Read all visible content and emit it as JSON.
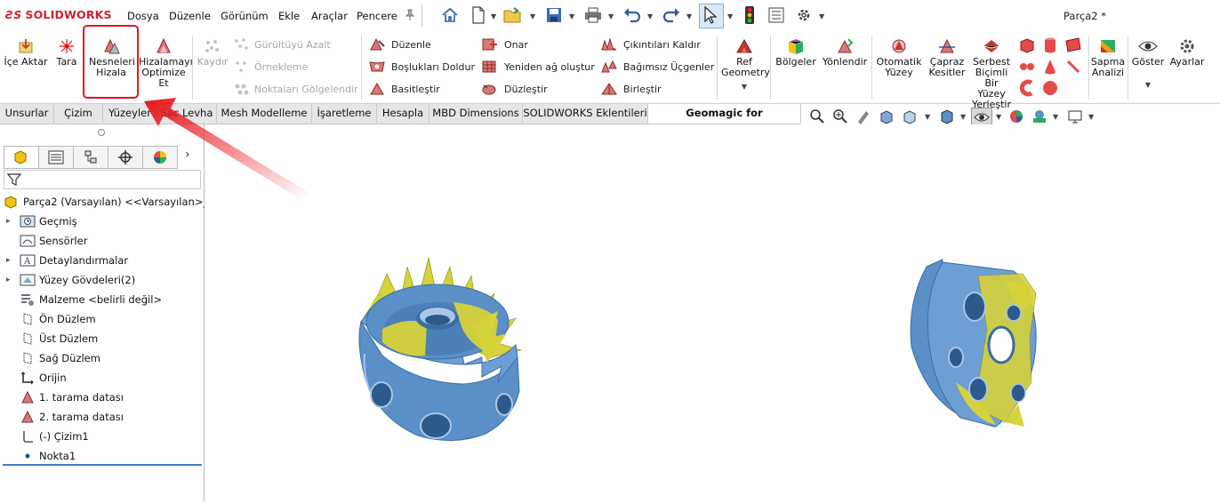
{
  "app": {
    "logo": {
      "ds": "ƧS",
      "brand_bold": "SOLID",
      "brand_rest": "WORKS"
    },
    "document_title": "Parça2 *"
  },
  "menu": [
    "Dosya",
    "Düzenle",
    "Görünüm",
    "Ekle",
    "Araçlar",
    "Pencere"
  ],
  "ribbon": {
    "import_label": "İçe Aktar",
    "scan_label": "Tara",
    "align_label": "Nesneleri Hizala",
    "optimize_label": "Hizalamayı Optimize Et",
    "remove_label": "Kaydır",
    "noise_label": "Gürültüyü Azalt",
    "sample_label": "Örnekleme",
    "shade_label": "Noktaları Gölgelendir",
    "edit_label": "Düzenle",
    "fill_label": "Boşlukları Doldur",
    "simplify_label": "Basitleştir",
    "repair_label": "Onar",
    "remesh_label": "Yeniden ağ oluştur",
    "smooth_label": "Düzleştir",
    "defeature_label": "Çıkıntıları Kaldır",
    "indep_label": "Bağımsız Üçgenler",
    "merge_label": "Birleştir",
    "refgeom_label": "Ref Geometry",
    "regions_label": "Bölgeler",
    "orient_label": "Yönlendir",
    "autosurf_label": "Otomatik Yüzey",
    "cross_label": "Çapraz Kesitler",
    "freeform_label": "Serbest Biçimli Bir Yüzey Yerleştir",
    "deviation_label": "Sapma Analizi",
    "show_label": "Göster",
    "settings_label": "Ayarlar"
  },
  "tabs": [
    "Unsurlar",
    "Çizim",
    "Yüzeyler",
    "Sac Levha",
    "Mesh Modelleme",
    "İşaretleme",
    "Hesapla",
    "MBD Dimensions",
    "SOLIDWORKS Eklentileri",
    "Geomagic for SOLIDWORKS"
  ],
  "tree": {
    "root": "Parça2 (Varsayılan) <<Varsayılan>_Gö",
    "items": [
      "Geçmiş",
      "Sensörler",
      "Detaylandırmalar",
      "Yüzey Gövdeleri(2)",
      "Malzeme <belirli değil>",
      "Ön Düzlem",
      "Üst Düzlem",
      "Sağ Düzlem",
      "Orijin",
      "1. tarama datası",
      "2. tarama datası",
      "(-) Çizim1",
      "Nokta1"
    ]
  },
  "colors": {
    "accent_red": "#e8141c",
    "mesh_blue": "#5a8fc8",
    "mesh_yellow": "#d6d23a",
    "brand_red": "#d2202f"
  }
}
